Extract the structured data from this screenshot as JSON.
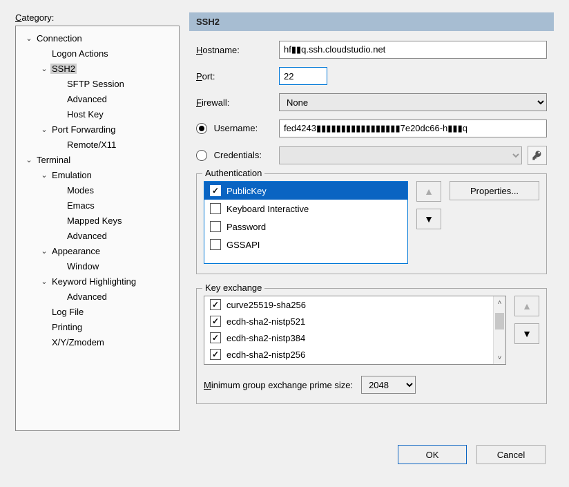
{
  "category_label": "Category:",
  "tree": [
    {
      "depth": 0,
      "twisty": "v",
      "label": "Connection",
      "name": "tree-connection"
    },
    {
      "depth": 1,
      "twisty": "",
      "label": "Logon Actions",
      "name": "tree-logon-actions"
    },
    {
      "depth": 1,
      "twisty": "v",
      "label": "SSH2",
      "name": "tree-ssh2",
      "selected": true
    },
    {
      "depth": 2,
      "twisty": "",
      "label": "SFTP Session",
      "name": "tree-sftp-session"
    },
    {
      "depth": 2,
      "twisty": "",
      "label": "Advanced",
      "name": "tree-ssh2-advanced"
    },
    {
      "depth": 2,
      "twisty": "",
      "label": "Host Key",
      "name": "tree-host-key"
    },
    {
      "depth": 1,
      "twisty": "v",
      "label": "Port Forwarding",
      "name": "tree-port-forwarding"
    },
    {
      "depth": 2,
      "twisty": "",
      "label": "Remote/X11",
      "name": "tree-remote-x11"
    },
    {
      "depth": 0,
      "twisty": "v",
      "label": "Terminal",
      "name": "tree-terminal"
    },
    {
      "depth": 1,
      "twisty": "v",
      "label": "Emulation",
      "name": "tree-emulation"
    },
    {
      "depth": 2,
      "twisty": "",
      "label": "Modes",
      "name": "tree-modes"
    },
    {
      "depth": 2,
      "twisty": "",
      "label": "Emacs",
      "name": "tree-emacs"
    },
    {
      "depth": 2,
      "twisty": "",
      "label": "Mapped Keys",
      "name": "tree-mapped-keys"
    },
    {
      "depth": 2,
      "twisty": "",
      "label": "Advanced",
      "name": "tree-emulation-advanced"
    },
    {
      "depth": 1,
      "twisty": "v",
      "label": "Appearance",
      "name": "tree-appearance"
    },
    {
      "depth": 2,
      "twisty": "",
      "label": "Window",
      "name": "tree-window"
    },
    {
      "depth": 1,
      "twisty": "v",
      "label": "Keyword Highlighting",
      "name": "tree-keyword-highlighting"
    },
    {
      "depth": 2,
      "twisty": "",
      "label": "Advanced",
      "name": "tree-kh-advanced"
    },
    {
      "depth": 1,
      "twisty": "",
      "label": "Log File",
      "name": "tree-log-file"
    },
    {
      "depth": 1,
      "twisty": "",
      "label": "Printing",
      "name": "tree-printing"
    },
    {
      "depth": 1,
      "twisty": "",
      "label": "X/Y/Zmodem",
      "name": "tree-xyzmodem"
    }
  ],
  "panel_title": "SSH2",
  "labels": {
    "hostname": "Hostname:",
    "port": "Port:",
    "firewall": "Firewall:",
    "username": "Username:",
    "credentials": "Credentials:",
    "authentication": "Authentication",
    "keyexchange": "Key exchange",
    "min_group": "Minimum group exchange prime size:",
    "properties": "Properties...",
    "ok": "OK",
    "cancel": "Cancel"
  },
  "values": {
    "hostname": "hf▮▮q.ssh.cloudstudio.net",
    "port": "22",
    "firewall": "None",
    "username": "fed4243▮▮▮▮▮▮▮▮▮▮▮▮▮▮▮▮▮7e20dc66-h▮▮▮q",
    "credentials": "",
    "min_group": "2048"
  },
  "auth_mode": "username",
  "auth_methods": [
    {
      "label": "PublicKey",
      "checked": true,
      "selected": true
    },
    {
      "label": "Keyboard Interactive",
      "checked": false,
      "selected": false
    },
    {
      "label": "Password",
      "checked": false,
      "selected": false
    },
    {
      "label": "GSSAPI",
      "checked": false,
      "selected": false
    }
  ],
  "kex": [
    {
      "label": "curve25519-sha256",
      "checked": true
    },
    {
      "label": "ecdh-sha2-nistp521",
      "checked": true
    },
    {
      "label": "ecdh-sha2-nistp384",
      "checked": true
    },
    {
      "label": "ecdh-sha2-nistp256",
      "checked": true
    }
  ]
}
